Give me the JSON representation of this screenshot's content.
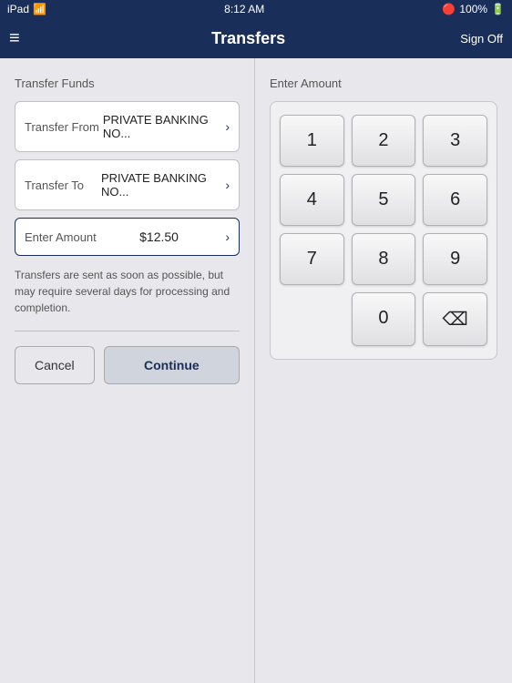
{
  "statusBar": {
    "carrier": "iPad",
    "wifi": "wifi",
    "time": "8:12 AM",
    "battery": "100%"
  },
  "navBar": {
    "title": "Transfers",
    "menuIcon": "≡",
    "signOff": "Sign Off"
  },
  "leftPanel": {
    "sectionLabel": "Transfer Funds",
    "transferFrom": {
      "label": "Transfer From",
      "value": "PRIVATE BANKING NO... "
    },
    "transferTo": {
      "label": "Transfer To",
      "value": "PRIVATE BANKING NO... "
    },
    "enterAmount": {
      "label": "Enter Amount",
      "value": "$12.50 "
    },
    "infoText": "Transfers are sent as soon as possible, but may require several days for processing and completion.",
    "cancelBtn": "Cancel",
    "continueBtn": "Continue"
  },
  "rightPanel": {
    "sectionLabel": "Enter Amount",
    "numpad": {
      "keys": [
        "1",
        "2",
        "3",
        "4",
        "5",
        "6",
        "7",
        "8",
        "9",
        "",
        "0",
        "⌫"
      ]
    }
  }
}
